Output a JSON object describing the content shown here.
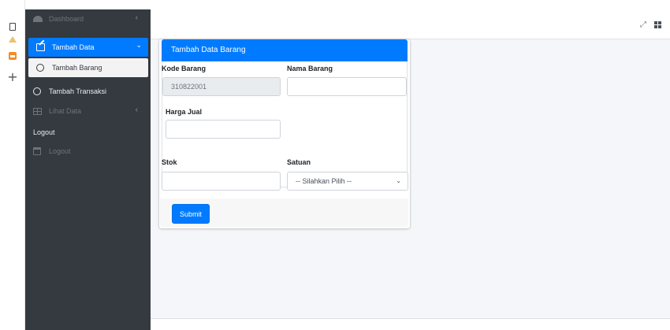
{
  "sidebar": {
    "items": [
      {
        "label": "Dashboard",
        "icon": "dashboard-icon"
      },
      {
        "label": "Tambah Data",
        "icon": "edit-icon"
      },
      {
        "label": "Tambah Barang",
        "icon": "circle-icon"
      },
      {
        "label": "Tambah Transaksi",
        "icon": "circle-icon"
      },
      {
        "label": "Lihat Data",
        "icon": "table-icon"
      },
      {
        "label": "Logout",
        "icon": "calendar-icon"
      }
    ],
    "logout_header": "Logout",
    "active_color": "#007bff",
    "bg_color": "#343a40"
  },
  "topbar": {
    "expand_icon": "expand-icon",
    "apps_icon": "apps-icon"
  },
  "form": {
    "title": "Tambah Data Barang",
    "kode_label": "Kode Barang",
    "kode_value": "310822001",
    "nama_label": "Nama Barang",
    "nama_value": "",
    "harga_label": "Harga Jual",
    "harga_value": "",
    "stok_label": "Stok",
    "stok_value": "",
    "satuan_label": "Satuan",
    "satuan_selected": "-- Silahkan Pilih --",
    "submit_label": "Submit"
  }
}
